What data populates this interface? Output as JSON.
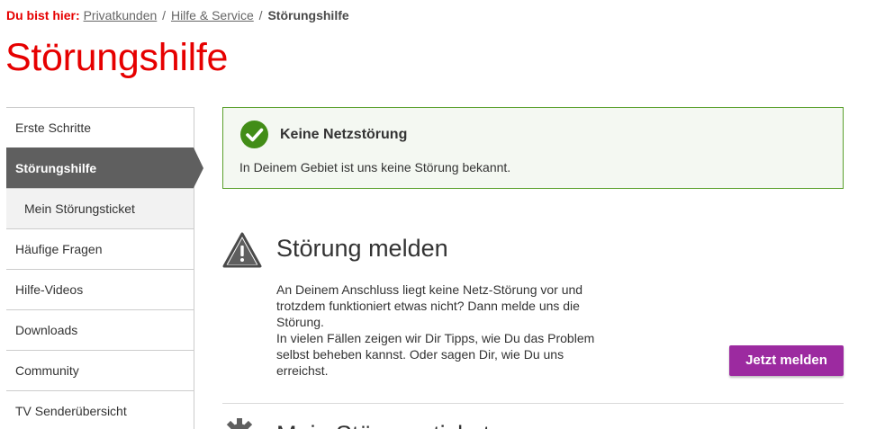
{
  "breadcrumb": {
    "prefix": "Du bist hier:",
    "links": [
      "Privatkunden",
      "Hilfe & Service"
    ],
    "separator": "/",
    "current": "Störungshilfe"
  },
  "page_title": "Störungshilfe",
  "sidebar": {
    "items": [
      {
        "label": "Erste Schritte"
      },
      {
        "label": "Störungshilfe"
      },
      {
        "label": "Mein Störungsticket"
      },
      {
        "label": "Häufige Fragen"
      },
      {
        "label": "Hilfe-Videos"
      },
      {
        "label": "Downloads"
      },
      {
        "label": "Community"
      },
      {
        "label": "TV Senderübersicht"
      }
    ]
  },
  "status": {
    "title": "Keine Netzstörung",
    "text": "In Deinem Gebiet ist uns keine Störung bekannt."
  },
  "report": {
    "title": "Störung melden",
    "lines": [
      "An Deinem Anschluss liegt keine Netz-Störung vor und trotzdem funktioniert etwas nicht? Dann melde uns die Störung.",
      "In vielen Fällen zeigen wir Dir Tipps, wie Du das Problem selbst beheben kannst. Oder sagen Dir, wie Du uns erreichst."
    ],
    "button_label": "Jetzt melden"
  },
  "next_section": {
    "title": "Mein Störungsticket"
  },
  "colors": {
    "brand_red": "#e60000",
    "active_nav": "#5f5f5f",
    "success_green": "#5aa02c",
    "button_purple": "#9c2aa0"
  },
  "icons": {
    "status": "check-circle-icon",
    "report": "warning-triangle-icon",
    "next": "gear-icon"
  }
}
